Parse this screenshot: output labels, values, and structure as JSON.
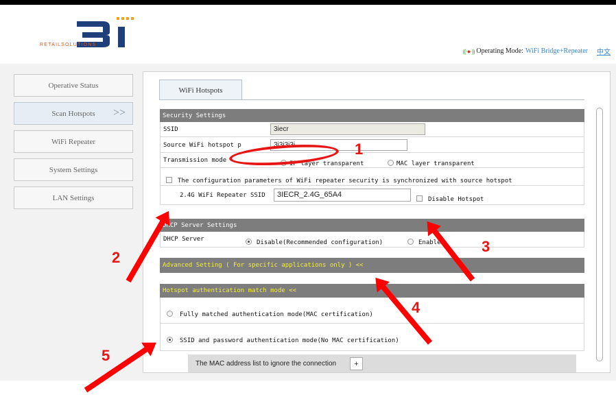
{
  "brand": {
    "logo_text": "RETAILSOLUTIONS",
    "logo_colors": {
      "primary": "#1f3f7a",
      "accent": "#f0a21e",
      "text": "#d25a1e"
    }
  },
  "header": {
    "mode_prefix": "Operating Mode:",
    "mode_value": "WiFi Bridge+Repeater",
    "language_link": "中文",
    "signal_icon": "wifi-signal-icon"
  },
  "sidebar": {
    "items": [
      {
        "label": "Operative Status",
        "active": false
      },
      {
        "label": "Scan Hotspots",
        "active": true,
        "chevron": ">>"
      },
      {
        "label": "WiFi Repeater",
        "active": false
      },
      {
        "label": "System Settings",
        "active": false
      },
      {
        "label": "LAN Settings",
        "active": false
      }
    ]
  },
  "tab": {
    "label": "WiFi Hotspots"
  },
  "security": {
    "header": "Security Settings",
    "ssid_label": "SSID",
    "ssid_value": "3iecr",
    "source_pwd_label": "Source WiFi hotspot p",
    "source_pwd_value": "3i3i3i3i",
    "transmission_label": "Transmission mode",
    "transmission_opt1": "IP layer transparent",
    "transmission_opt2": "MAC layer transparent",
    "sync_label": "The configuration parameters of WiFi repeater security is synchronized with source hotspot",
    "repeater_ssid_label": "2.4G WiFi Repeater SSID",
    "repeater_ssid_value": "3IECR_2.4G_65A4",
    "disable_hotspot_label": "Disable Hotspot"
  },
  "dhcp": {
    "header": "DHCP Server Settings",
    "label": "DHCP Server",
    "opt_disable": "Disable(Recommended configuration)",
    "opt_enable": "Enable"
  },
  "advanced": {
    "header": "Advanced Setting ( For specific applications only ) <<"
  },
  "auth": {
    "header": "Hotspot authentication match mode <<",
    "opt_full": "Fully matched authentication mode(MAC certification)",
    "opt_ssid": "SSID and password authentication mode(No MAC certification)",
    "mac_list_label": "The MAC address list to ignore the connection",
    "add_button": "+"
  },
  "annotations": {
    "color": "#e81515",
    "numbers": [
      "1",
      "2",
      "3",
      "4",
      "5"
    ]
  }
}
